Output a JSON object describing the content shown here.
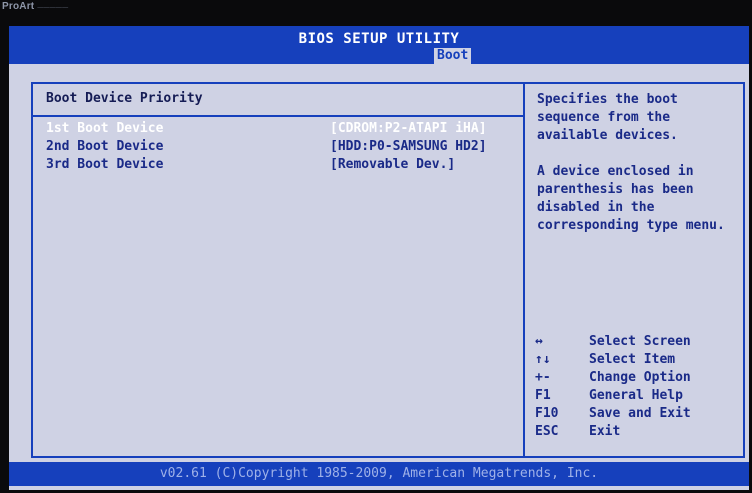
{
  "monitor": {
    "brand": "ProArt",
    "tagline": "—————"
  },
  "header": {
    "title": "BIOS SETUP UTILITY",
    "active_tab": "Boot"
  },
  "main": {
    "section_title": "Boot Device Priority",
    "boot_devices": [
      {
        "label": "1st Boot Device",
        "value": "[CDROM:P2-ATAPI iHA]"
      },
      {
        "label": "2nd Boot Device",
        "value": "[HDD:P0-SAMSUNG HD2]"
      },
      {
        "label": "3rd Boot Device",
        "value": "[Removable Dev.]"
      }
    ]
  },
  "help": {
    "description": "Specifies the boot sequence from the available devices.",
    "note": "A device enclosed in parenthesis has been disabled in the corresponding type menu."
  },
  "keys": [
    {
      "key": "↔",
      "desc": "Select Screen"
    },
    {
      "key": "↑↓",
      "desc": "Select Item"
    },
    {
      "key": "+-",
      "desc": "Change Option"
    },
    {
      "key": "F1",
      "desc": "General Help"
    },
    {
      "key": "F10",
      "desc": "Save and Exit"
    },
    {
      "key": "ESC",
      "desc": "Exit"
    }
  ],
  "footer": {
    "copyright": "v02.61 (C)Copyright 1985-2009, American Megatrends, Inc."
  },
  "colors": {
    "background": "#cfd2e4",
    "accent": "#1640bc",
    "text": "#1a2a88",
    "selected": "#ffffff"
  }
}
